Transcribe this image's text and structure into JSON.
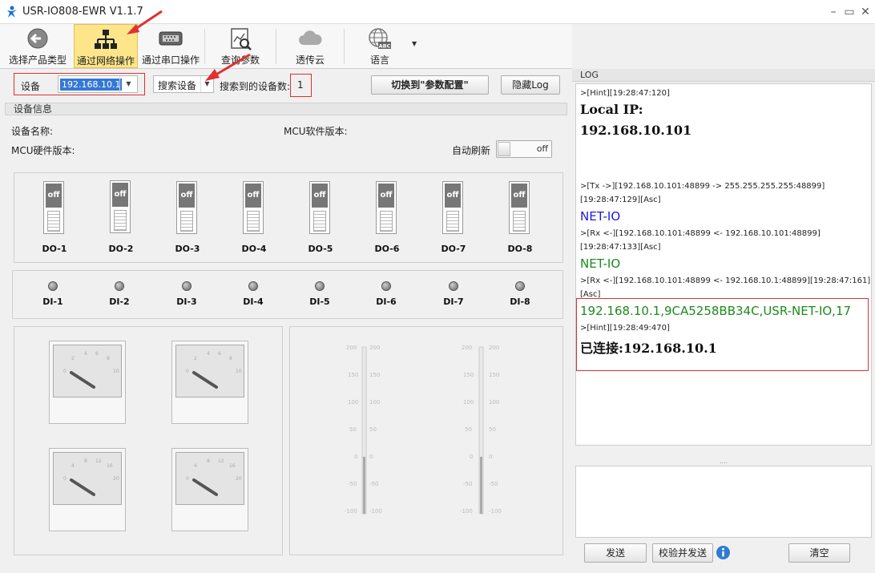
{
  "window": {
    "title": "USR-IO808-EWR V1.1.7"
  },
  "toolbar": {
    "select_type": "选择产品类型",
    "net_op": "通过网络操作",
    "serial_op": "通过串口操作",
    "query_params": "查询参数",
    "cloud": "透传云",
    "language": "语言"
  },
  "device_bar": {
    "device_label": "设备",
    "device_ip": "192.168.10.1",
    "search_label": "搜索设备",
    "found_label": "搜索到的设备数:",
    "found_count": "1",
    "switch_button": "切换到\"参数配置\"",
    "hide_log": "隐藏Log"
  },
  "device_info": {
    "section_title": "设备信息",
    "name_label": "设备名称:",
    "mcu_sw_label": "MCU软件版本:",
    "mcu_hw_label": "MCU硬件版本:",
    "auto_refresh_label": "自动刷新",
    "auto_refresh_state": "off"
  },
  "do": [
    {
      "label": "DO-1",
      "state": "off"
    },
    {
      "label": "DO-2",
      "state": "off"
    },
    {
      "label": "DO-3",
      "state": "off"
    },
    {
      "label": "DO-4",
      "state": "off"
    },
    {
      "label": "DO-5",
      "state": "off"
    },
    {
      "label": "DO-6",
      "state": "off"
    },
    {
      "label": "DO-7",
      "state": "off"
    },
    {
      "label": "DO-8",
      "state": "off"
    }
  ],
  "di": [
    "DI-1",
    "DI-2",
    "DI-3",
    "DI-4",
    "DI-5",
    "DI-6",
    "DI-7",
    "DI-8"
  ],
  "gauges": {
    "upper_ticks": [
      "0",
      "2",
      "4",
      "6",
      "8",
      "10"
    ],
    "lower_ticks": [
      "0",
      "4",
      "8",
      "12",
      "16",
      "20"
    ],
    "bar_ticks": [
      "200",
      "150",
      "100",
      "50",
      "0",
      "-50",
      "-100"
    ]
  },
  "log": {
    "title": "LOG",
    "lines": [
      ">[Hint][19:28:47:120]",
      "Local IP:",
      "192.168.10.101",
      ">[Tx ->][192.168.10.101:48899 -> 255.255.255.255:48899]",
      "[19:28:47:129][Asc]",
      "NET-IO",
      ">[Rx <-][192.168.10.101:48899 <- 192.168.10.101:48899]",
      "[19:28:47:133][Asc]",
      "NET-IO",
      ">[Rx <-][192.168.10.101:48899 <- 192.168.10.1:48899][19:28:47:161]",
      "[Asc]",
      "192.168.10.1,9CA5258BB34C,USR-NET-IO,17",
      ">[Hint][19:28:49:470]",
      "已连接:192.168.10.1"
    ],
    "splitter": "....",
    "send": "发送",
    "check_send": "校验并发送",
    "clear": "清空"
  },
  "colors": {
    "accent_red": "#e03030",
    "log_blue": "#1a1adc",
    "log_green": "#1d8a1d",
    "active_tab": "#fde58a"
  }
}
